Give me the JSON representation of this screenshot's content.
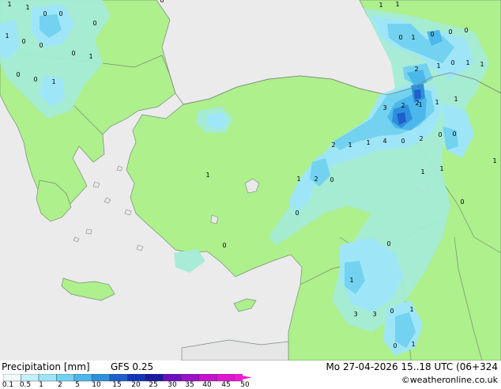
{
  "footer": {
    "title": "Precipitation [mm]",
    "model": "GFS 0.25",
    "datetime": "Mo 27-04-2026 15..18 UTC (06+324",
    "credit": "©weatheronline.co.uk"
  },
  "legend": {
    "ticks": [
      "0.1",
      "0.5",
      "1",
      "2",
      "5",
      "10",
      "15",
      "20",
      "25",
      "30",
      "35",
      "40",
      "45",
      "50"
    ],
    "colors": [
      "#f0fbff",
      "#c6f0fa",
      "#9ee6f7",
      "#73d2f0",
      "#4cb7eb",
      "#2d90dc",
      "#1f60cc",
      "#1535b8",
      "#1a1aa0",
      "#6d0fbd",
      "#9a12c7",
      "#c514cf",
      "#e016d4",
      "#f21ad8"
    ]
  },
  "colors": {
    "sea": "#ebebeb",
    "land": "#adf08c",
    "light_rain": "#a4ebd6",
    "rain_1": "#9ee6f7",
    "rain_2": "#73d2f0",
    "rain_5": "#4cb7eb",
    "rain_10": "#2d90dc",
    "rain_15": "#1f60cc",
    "rain_20": "#1535b8"
  },
  "map_values": [
    "1",
    "1",
    "0",
    "0",
    "0",
    "1",
    "0",
    "0",
    "0",
    "1",
    "0",
    "0",
    "0",
    "1",
    "1",
    "1",
    "0",
    "1",
    "0",
    "0",
    "0",
    "0",
    "1",
    "2",
    "1",
    "1",
    "1",
    "1",
    "2",
    "1",
    "3",
    "2",
    "2",
    "1",
    "1",
    "4",
    "0",
    "2",
    "0",
    "0",
    "1",
    "1",
    "2",
    "0",
    "1",
    "1",
    "0",
    "0",
    "1",
    "0",
    "1",
    "3",
    "3",
    "0",
    "1",
    "0",
    "1",
    "0"
  ]
}
